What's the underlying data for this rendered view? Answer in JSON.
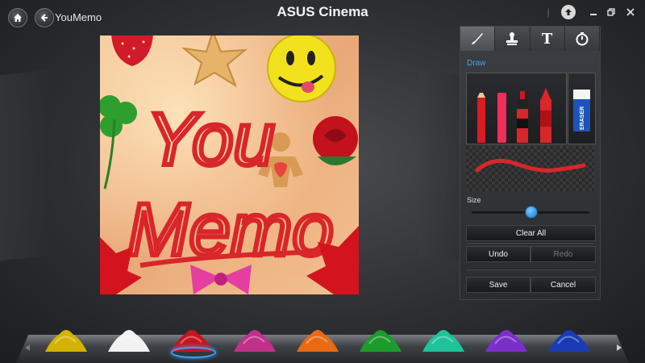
{
  "header": {
    "title": "ASUS Cinema",
    "app_name": "YouMemo"
  },
  "panel": {
    "tabs": [
      {
        "icon": "brush-icon",
        "active": true
      },
      {
        "icon": "stamp-icon",
        "active": false
      },
      {
        "icon": "text-icon",
        "label": "T",
        "active": false
      },
      {
        "icon": "timer-icon",
        "active": false
      }
    ],
    "section_label": "Draw",
    "tools": [
      "pencil",
      "chalk",
      "marker",
      "crayon"
    ],
    "eraser_label": "ERASER",
    "size_label": "Size",
    "size_value": 0.5,
    "stroke_color": "#d8262a",
    "clear_label": "Clear All",
    "undo_label": "Undo",
    "redo_label": "Redo",
    "save_label": "Save",
    "cancel_label": "Cancel"
  },
  "canvas": {
    "text_line_1": "You",
    "text_line_2": "Memo",
    "stickers": [
      "strawberry",
      "starfish",
      "smiley",
      "clover",
      "rose",
      "gingerbread-man",
      "ribbon-bow",
      "maple-leaf"
    ]
  },
  "palette": {
    "colors": [
      "#d4b300",
      "#f2f2f2",
      "#c8141e",
      "#c0318a",
      "#e86a12",
      "#1c9c2a",
      "#1fc39a",
      "#7b2fc8",
      "#1a3bb5"
    ],
    "selected_index": 2
  },
  "accent_color": "#3fa0ff"
}
